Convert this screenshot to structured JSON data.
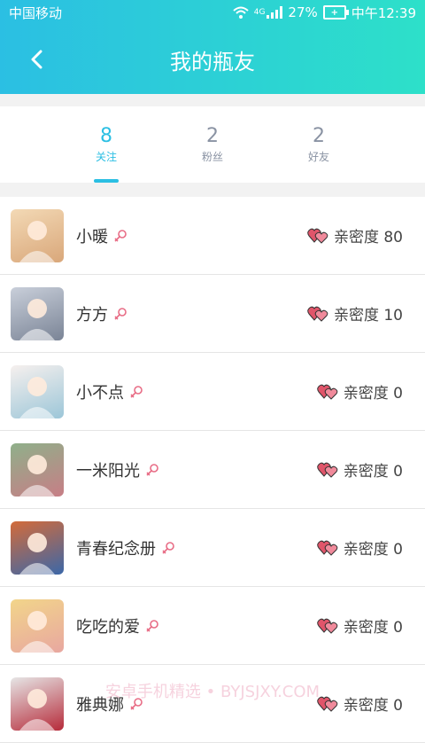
{
  "status": {
    "carrier": "中国移动",
    "network": "4G",
    "battery": "27%",
    "time": "中午12:39"
  },
  "header": {
    "title": "我的瓶友"
  },
  "tabs": [
    {
      "count": "8",
      "label": "关注"
    },
    {
      "count": "2",
      "label": "粉丝"
    },
    {
      "count": "2",
      "label": "好友"
    }
  ],
  "friends": [
    {
      "name": "小暖",
      "intimacy": "亲密度 80"
    },
    {
      "name": "方方",
      "intimacy": "亲密度 10"
    },
    {
      "name": "小不点",
      "intimacy": "亲密度 0"
    },
    {
      "name": "一米阳光",
      "intimacy": "亲密度 0"
    },
    {
      "name": "青春纪念册",
      "intimacy": "亲密度 0"
    },
    {
      "name": "吃吃的爱",
      "intimacy": "亲密度 0"
    },
    {
      "name": "雅典娜",
      "intimacy": "亲密度 0"
    }
  ],
  "watermark": "安卓手机精选 • BYJSJXY.COM",
  "colors": {
    "accent": "#2bbfe3",
    "accent2": "#2de0c9",
    "heart": "#e0556a",
    "female": "#e86d86"
  }
}
